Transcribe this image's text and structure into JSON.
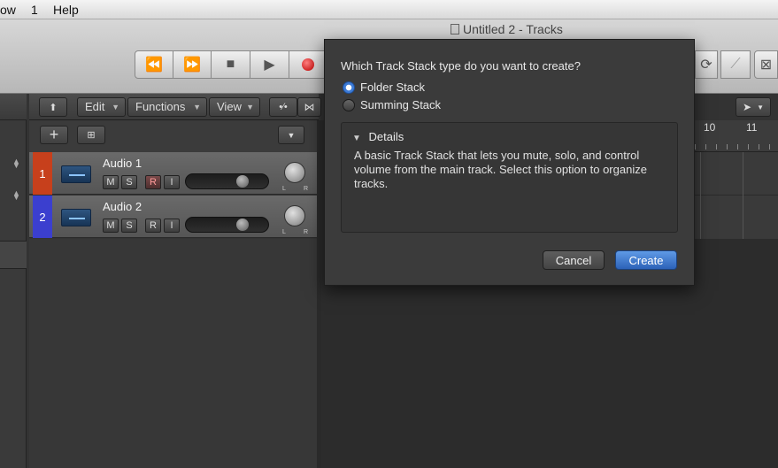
{
  "menubar": {
    "items": [
      "ow",
      "1",
      "Help"
    ]
  },
  "window": {
    "title": "Untitled 2 - Tracks"
  },
  "toolbar": {
    "rewind": "⏪",
    "forward": "⏩",
    "stop": "■",
    "play": "▶"
  },
  "tracks_toolbar": {
    "edit": "Edit",
    "functions": "Functions",
    "view": "View"
  },
  "tracks": [
    {
      "number": "1",
      "name": "Audio 1",
      "color": "#c7401c",
      "m": "M",
      "s": "S",
      "r": "R",
      "i": "I",
      "r_active": true
    },
    {
      "number": "2",
      "name": "Audio 2",
      "color": "#3b3fcf",
      "m": "M",
      "s": "S",
      "r": "R",
      "i": "I",
      "r_active": false
    }
  ],
  "ruler": {
    "bar10": "10",
    "bar11": "11"
  },
  "dialog": {
    "question": "Which Track Stack type do you want to create?",
    "options": [
      {
        "label": "Folder Stack",
        "selected": true
      },
      {
        "label": "Summing Stack",
        "selected": false
      }
    ],
    "details_title": "Details",
    "details_text": "A basic Track Stack that lets you mute, solo, and control volume from the main track. Select this option to organize tracks.",
    "cancel": "Cancel",
    "create": "Create"
  },
  "colors": {
    "accent": "#3d7bd6",
    "track1": "#c7401c",
    "track2": "#3b3fcf"
  }
}
